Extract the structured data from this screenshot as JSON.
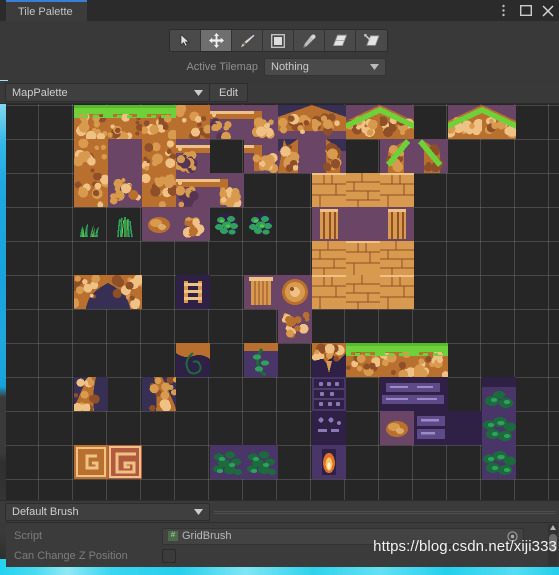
{
  "window": {
    "tab_label": "Tile Palette",
    "controls": [
      {
        "name": "overflow-menu-icon",
        "glyph": "kebab"
      },
      {
        "name": "maximize-icon",
        "glyph": "square"
      },
      {
        "name": "close-icon",
        "glyph": "x"
      }
    ]
  },
  "toolbar": {
    "tools": [
      {
        "name": "select-tool",
        "icon": "cursor-icon",
        "selected": false
      },
      {
        "name": "move-tool",
        "icon": "move-arrows-icon",
        "selected": true
      },
      {
        "name": "paint-tool",
        "icon": "paintbrush-icon",
        "selected": false
      },
      {
        "name": "box-fill-tool",
        "icon": "square-fill-icon",
        "selected": false
      },
      {
        "name": "picker-tool",
        "icon": "eyedropper-icon",
        "selected": false
      },
      {
        "name": "erase-tool",
        "icon": "eraser-icon",
        "selected": false
      },
      {
        "name": "flood-fill-tool",
        "icon": "paint-bucket-icon",
        "selected": false
      }
    ],
    "active_tilemap_label": "Active Tilemap",
    "active_tilemap_value": "Nothing"
  },
  "palette": {
    "name": "MapPalette",
    "edit_label": "Edit"
  },
  "brush": {
    "name": "Default Brush"
  },
  "inspector": {
    "rows": [
      {
        "label": "Script",
        "value": "GridBrush",
        "type": "object",
        "badge": "#"
      },
      {
        "label": "Can Change Z Position",
        "value": "",
        "type": "checkbox",
        "checked": false
      }
    ]
  },
  "watermark": "https://blog.csdn.net/xiji333",
  "colors": {
    "accent_tab": "#3b7fd4",
    "panel": "#393939",
    "canvas": "#262626",
    "grid_line": "#969696",
    "dirt": "#c07a38",
    "grass": "#6ed13a",
    "stone_purple": "#6b4566",
    "vine_green": "#2f9a5e",
    "bleed_cyan": "#23d0ee"
  },
  "tile_grid": {
    "cell_size": 34,
    "origin_x": 0,
    "origin_y": 1,
    "cols": 16,
    "rows": 12,
    "tiles": [
      {
        "col": 2,
        "row": 0,
        "kind": "grass-top"
      },
      {
        "col": 3,
        "row": 0,
        "kind": "grass-top"
      },
      {
        "col": 4,
        "row": 0,
        "kind": "grass-top"
      },
      {
        "col": 5,
        "row": 0,
        "kind": "dirt-face"
      },
      {
        "col": 6,
        "row": 0,
        "kind": "ledge-left"
      },
      {
        "col": 7,
        "row": 0,
        "kind": "ledge-right"
      },
      {
        "col": 8,
        "row": 0,
        "kind": "slope-dirt-rl"
      },
      {
        "col": 9,
        "row": 0,
        "kind": "slope-dirt-lr"
      },
      {
        "col": 10,
        "row": 0,
        "kind": "slope-grass-rl"
      },
      {
        "col": 11,
        "row": 0,
        "kind": "slope-grass-lr"
      },
      {
        "col": 13,
        "row": 0,
        "kind": "slope-grass-rl"
      },
      {
        "col": 14,
        "row": 0,
        "kind": "slope-grass-lr"
      },
      {
        "col": 2,
        "row": 1,
        "kind": "dirt-face"
      },
      {
        "col": 3,
        "row": 1,
        "kind": "stone-plain"
      },
      {
        "col": 4,
        "row": 1,
        "kind": "dirt-face"
      },
      {
        "col": 5,
        "row": 1,
        "kind": "ledge-left"
      },
      {
        "col": 7,
        "row": 1,
        "kind": "ledge-right"
      },
      {
        "col": 8,
        "row": 1,
        "kind": "slope-half-rl"
      },
      {
        "col": 9,
        "row": 1,
        "kind": "slope-half-lr"
      },
      {
        "col": 11,
        "row": 1,
        "kind": "slope-vine-rl"
      },
      {
        "col": 12,
        "row": 1,
        "kind": "slope-vine-lr"
      },
      {
        "col": 2,
        "row": 2,
        "kind": "dirt-face"
      },
      {
        "col": 3,
        "row": 2,
        "kind": "dirt-rubble"
      },
      {
        "col": 4,
        "row": 2,
        "kind": "dirt-face"
      },
      {
        "col": 5,
        "row": 2,
        "kind": "ledge-left"
      },
      {
        "col": 6,
        "row": 2,
        "kind": "ledge-right"
      },
      {
        "col": 9,
        "row": 2,
        "kind": "brick-block"
      },
      {
        "col": 10,
        "row": 2,
        "kind": "brick-wide"
      },
      {
        "col": 11,
        "row": 2,
        "kind": "brick-block"
      },
      {
        "col": 2,
        "row": 3,
        "kind": "grass-tuft"
      },
      {
        "col": 3,
        "row": 3,
        "kind": "grass-tall"
      },
      {
        "col": 4,
        "row": 3,
        "kind": "rock-small"
      },
      {
        "col": 5,
        "row": 3,
        "kind": "rock-tiny"
      },
      {
        "col": 6,
        "row": 3,
        "kind": "bush-green"
      },
      {
        "col": 7,
        "row": 3,
        "kind": "bush-green"
      },
      {
        "col": 9,
        "row": 3,
        "kind": "column-piece"
      },
      {
        "col": 10,
        "row": 3,
        "kind": "stone-plain"
      },
      {
        "col": 11,
        "row": 3,
        "kind": "column-piece"
      },
      {
        "col": 9,
        "row": 4,
        "kind": "brick-wide"
      },
      {
        "col": 10,
        "row": 4,
        "kind": "brick-block"
      },
      {
        "col": 11,
        "row": 4,
        "kind": "brick-wide"
      },
      {
        "col": 2,
        "row": 5,
        "kind": "stalactite-l"
      },
      {
        "col": 3,
        "row": 5,
        "kind": "stalactite-r"
      },
      {
        "col": 5,
        "row": 5,
        "kind": "ladder"
      },
      {
        "col": 7,
        "row": 5,
        "kind": "pillar"
      },
      {
        "col": 8,
        "row": 5,
        "kind": "medallion"
      },
      {
        "col": 9,
        "row": 5,
        "kind": "brick-block"
      },
      {
        "col": 10,
        "row": 5,
        "kind": "brick-wide"
      },
      {
        "col": 11,
        "row": 5,
        "kind": "brick-block"
      },
      {
        "col": 8,
        "row": 6,
        "kind": "dirt-rubble"
      },
      {
        "col": 5,
        "row": 7,
        "kind": "cave-vine-a"
      },
      {
        "col": 7,
        "row": 7,
        "kind": "cave-vine-b"
      },
      {
        "col": 9,
        "row": 7,
        "kind": "cave-drip"
      },
      {
        "col": 10,
        "row": 7,
        "kind": "grass-top"
      },
      {
        "col": 11,
        "row": 7,
        "kind": "grass-top"
      },
      {
        "col": 12,
        "row": 7,
        "kind": "grass-top"
      },
      {
        "col": 2,
        "row": 8,
        "kind": "stalagmite-l"
      },
      {
        "col": 4,
        "row": 8,
        "kind": "stalagmite-r"
      },
      {
        "col": 9,
        "row": 8,
        "kind": "door-panel"
      },
      {
        "col": 11,
        "row": 8,
        "kind": "sign-wide-l"
      },
      {
        "col": 12,
        "row": 8,
        "kind": "sign-wide-r"
      },
      {
        "col": 14,
        "row": 8,
        "kind": "moss-block"
      },
      {
        "col": 9,
        "row": 9,
        "kind": "door-panel-b"
      },
      {
        "col": 11,
        "row": 9,
        "kind": "rock-small"
      },
      {
        "col": 12,
        "row": 9,
        "kind": "sign-small"
      },
      {
        "col": 13,
        "row": 9,
        "kind": "stone-dark"
      },
      {
        "col": 14,
        "row": 9,
        "kind": "moss-wide"
      },
      {
        "col": 2,
        "row": 10,
        "kind": "glyph-small"
      },
      {
        "col": 3,
        "row": 10,
        "kind": "glyph-large"
      },
      {
        "col": 6,
        "row": 10,
        "kind": "bush-purple"
      },
      {
        "col": 7,
        "row": 10,
        "kind": "bush-purple"
      },
      {
        "col": 9,
        "row": 10,
        "kind": "torch"
      },
      {
        "col": 14,
        "row": 10,
        "kind": "moss-wide"
      }
    ]
  }
}
